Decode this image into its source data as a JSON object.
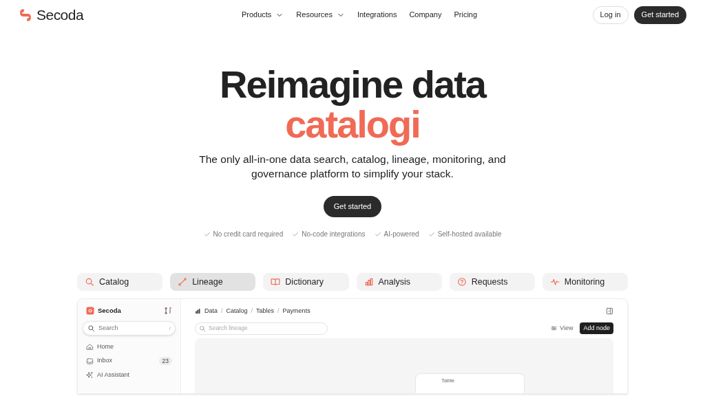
{
  "nav": {
    "logo": "Secoda",
    "links": [
      {
        "label": "Products",
        "dropdown": true
      },
      {
        "label": "Resources",
        "dropdown": true
      },
      {
        "label": "Integrations",
        "dropdown": false
      },
      {
        "label": "Company",
        "dropdown": false
      },
      {
        "label": "Pricing",
        "dropdown": false
      }
    ],
    "login": "Log in",
    "get_started": "Get started"
  },
  "hero": {
    "title": "Reimagine data",
    "title_accent": "catalogi",
    "subtitle": "The only all-in-one data search, catalog, lineage, monitoring, and governance platform to simplify your stack.",
    "cta": "Get started",
    "checks": [
      "No credit card required",
      "No-code integrations",
      "AI-powered",
      "Self-hosted available"
    ]
  },
  "tabs": [
    {
      "label": "Catalog",
      "kind": "search",
      "selected": false
    },
    {
      "label": "Lineage",
      "kind": "lineage",
      "selected": true
    },
    {
      "label": "Dictionary",
      "kind": "book",
      "selected": false
    },
    {
      "label": "Analysis",
      "kind": "chart",
      "selected": false
    },
    {
      "label": "Requests",
      "kind": "question",
      "selected": false
    },
    {
      "label": "Monitoring",
      "kind": "pulse",
      "selected": false
    }
  ],
  "app": {
    "sidebar": {
      "workspace": "Secoda",
      "search": {
        "placeholder": "Search",
        "shortcut": "/"
      },
      "items": [
        {
          "label": "Home",
          "kind": "home"
        },
        {
          "label": "Inbox",
          "kind": "inbox",
          "badge": "23"
        },
        {
          "label": "AI Assistant",
          "kind": "sparkle"
        }
      ]
    },
    "main": {
      "breadcrumb": [
        {
          "kind": "link",
          "label": "Data"
        },
        {
          "kind": "separator",
          "label": "/"
        },
        {
          "kind": "link",
          "label": "Catalog"
        },
        {
          "kind": "separator",
          "label": "/"
        },
        {
          "kind": "link",
          "label": "Tables"
        },
        {
          "kind": "separator",
          "label": "/"
        },
        {
          "kind": "link",
          "label": "Payments"
        }
      ],
      "search": {
        "placeholder": "Search lineage"
      },
      "view": "View",
      "add_node": "Add node",
      "node": {
        "type": "Table"
      }
    }
  }
}
